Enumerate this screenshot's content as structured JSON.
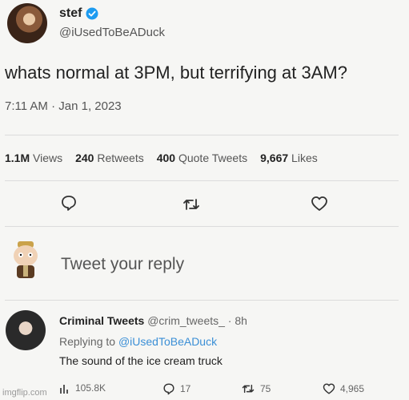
{
  "tweet": {
    "display_name": "stef",
    "handle": "@iUsedToBeADuck",
    "text": "whats normal at 3PM, but terrifying at 3AM?",
    "timestamp": "7:11 AM · Jan 1, 2023",
    "stats": {
      "views_value": "1.1M",
      "views_label": "Views",
      "retweets_value": "240",
      "retweets_label": "Retweets",
      "quotes_value": "400",
      "quotes_label": "Quote Tweets",
      "likes_value": "9,667",
      "likes_label": "Likes"
    },
    "icons": {
      "reply": "comment-icon",
      "retweet": "retweet-icon",
      "like": "heart-icon",
      "verified": "verified-badge-icon"
    }
  },
  "composer": {
    "placeholder": "Tweet your reply"
  },
  "reply": {
    "display_name": "Criminal Tweets",
    "handle": "@crim_tweets_",
    "separator": "·",
    "age": "8h",
    "replying_prefix": "Replying to",
    "replying_handle": "@iUsedToBeADuck",
    "text": "The sound of the ice cream truck",
    "views": "105.8K",
    "replies": "17",
    "retweets": "75",
    "likes": "4,965"
  },
  "watermark": "imgflip.com",
  "colors": {
    "background": "#f6f6f4",
    "verified_blue": "#1d9bf0",
    "link": "#3b8fd6"
  }
}
